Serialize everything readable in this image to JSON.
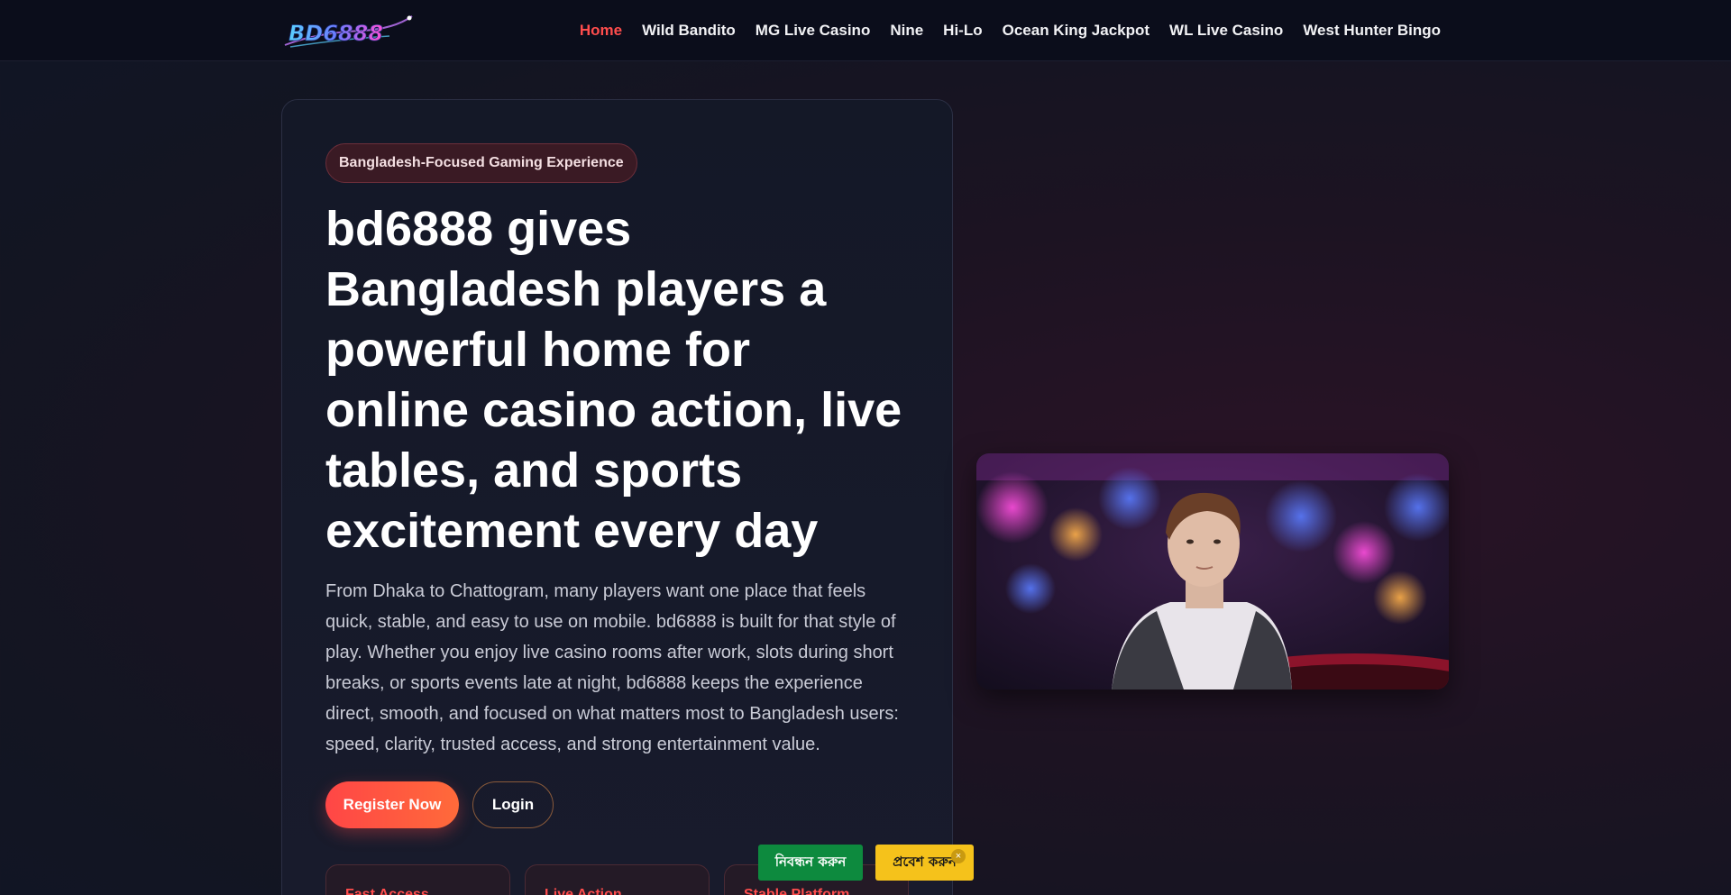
{
  "header": {
    "logo_text": "BD6888",
    "nav": [
      {
        "label": "Home",
        "active": true
      },
      {
        "label": "Wild Bandito"
      },
      {
        "label": "MG Live Casino"
      },
      {
        "label": "Nine"
      },
      {
        "label": "Hi-Lo"
      },
      {
        "label": "Ocean King Jackpot"
      },
      {
        "label": "WL Live Casino"
      },
      {
        "label": "West Hunter Bingo"
      }
    ]
  },
  "hero": {
    "badge": "Bangladesh-Focused Gaming Experience",
    "headline": "bd6888 gives Bangladesh players a powerful home for online casino action, live tables, and sports excitement every day",
    "description": "From Dhaka to Chattogram, many players want one place that feels quick, stable, and easy to use on mobile. bd6888 is built for that style of play. Whether you enjoy live casino rooms after work, slots during short breaks, or sports events late at night, bd6888 keeps the experience direct, smooth, and focused on what matters most to Bangladesh users: speed, clarity, trusted access, and strong entertainment value.",
    "register_label": "Register Now",
    "login_label": "Login",
    "features": [
      "Fast Access",
      "Live Action",
      "Stable Platform"
    ]
  },
  "floating": {
    "register_label": "নিবন্ধন করুন",
    "login_label": "প্রবেশ করুন",
    "close_icon": "×"
  },
  "colors": {
    "accent": "#ff4d4d",
    "header_bg": "#0b0d1b",
    "float_green": "#0d8a3e",
    "float_yellow": "#f5c21b"
  }
}
